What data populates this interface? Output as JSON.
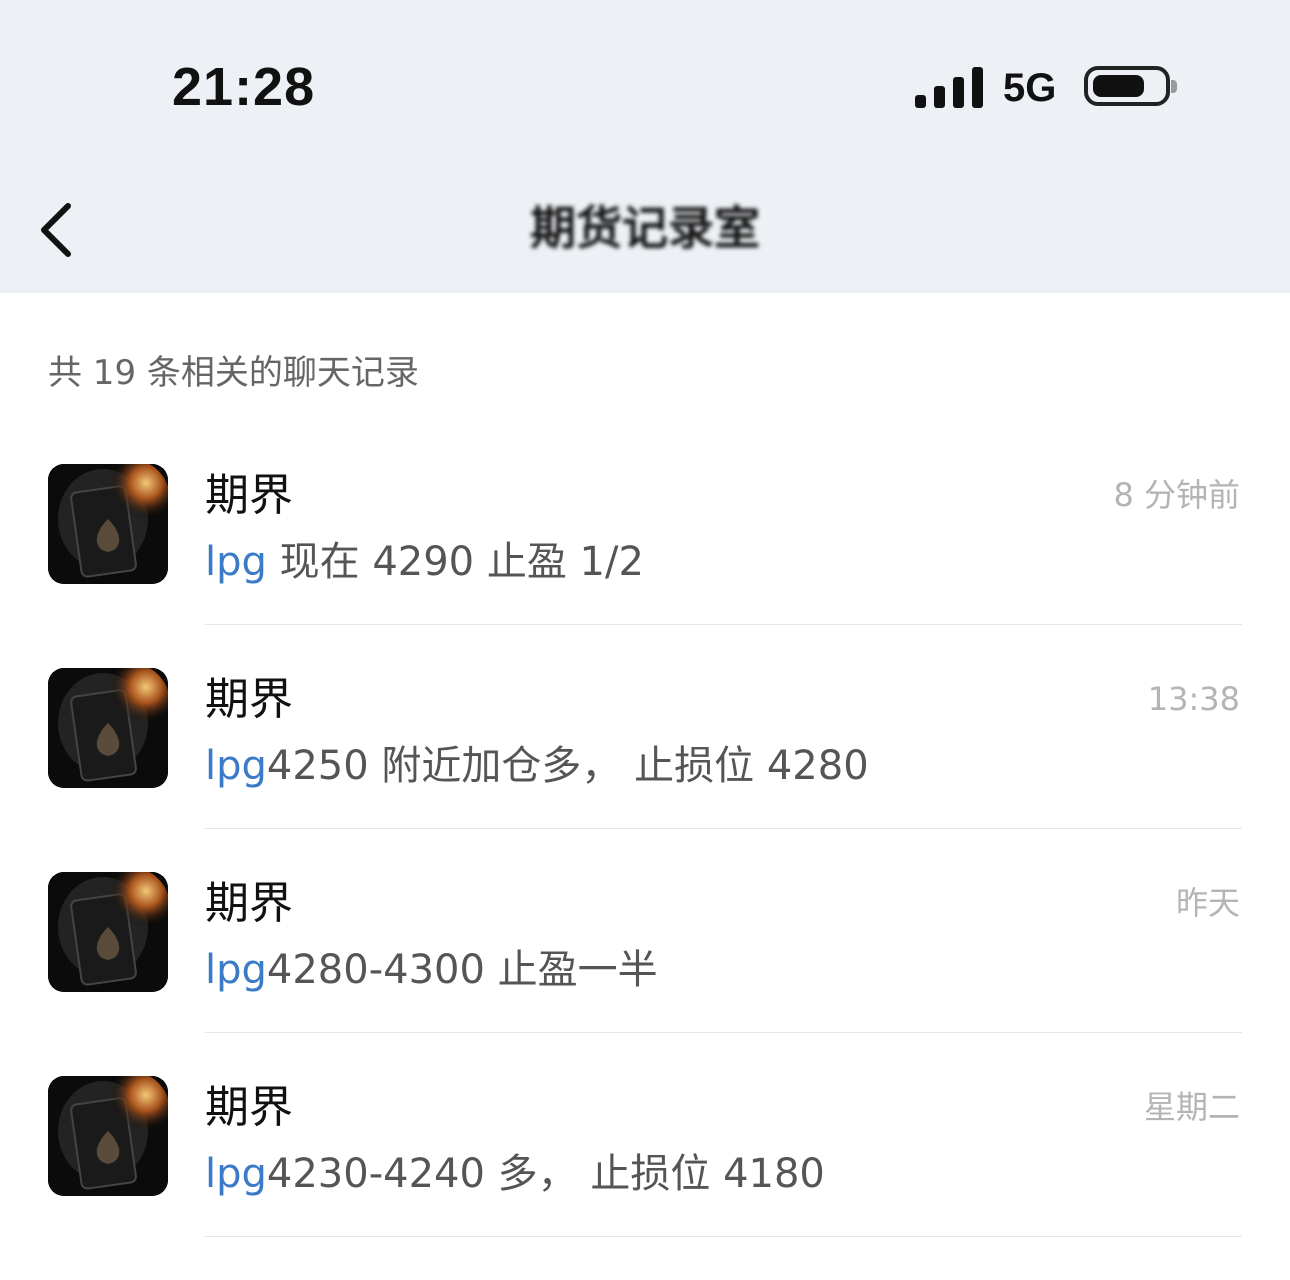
{
  "status_bar": {
    "time": "21:28",
    "network": "5G",
    "signal_bars": 4,
    "battery_level": 0.75
  },
  "nav": {
    "back_icon": "chevron-left-icon",
    "title": "期货记录室"
  },
  "results": {
    "count_label": "共 19 条相关的聊天记录",
    "items": [
      {
        "sender": "期界",
        "keyword": "lpg",
        "text": " 现在 4290 止盈 1/2",
        "time": "8 分钟前"
      },
      {
        "sender": "期界",
        "keyword": "lpg",
        "text": "4250 附近加仓多， 止损位 4280",
        "time": "13:38"
      },
      {
        "sender": "期界",
        "keyword": "lpg",
        "text": "4280-4300 止盈一半",
        "time": "昨天"
      },
      {
        "sender": "期界",
        "keyword": "lpg",
        "text": "4230-4240 多， 止损位 4180",
        "time": "星期二"
      }
    ]
  },
  "colors": {
    "header_bg": "#edf1f5",
    "keyword": "#3a7bc8",
    "timestamp": "#b4b4b4"
  }
}
